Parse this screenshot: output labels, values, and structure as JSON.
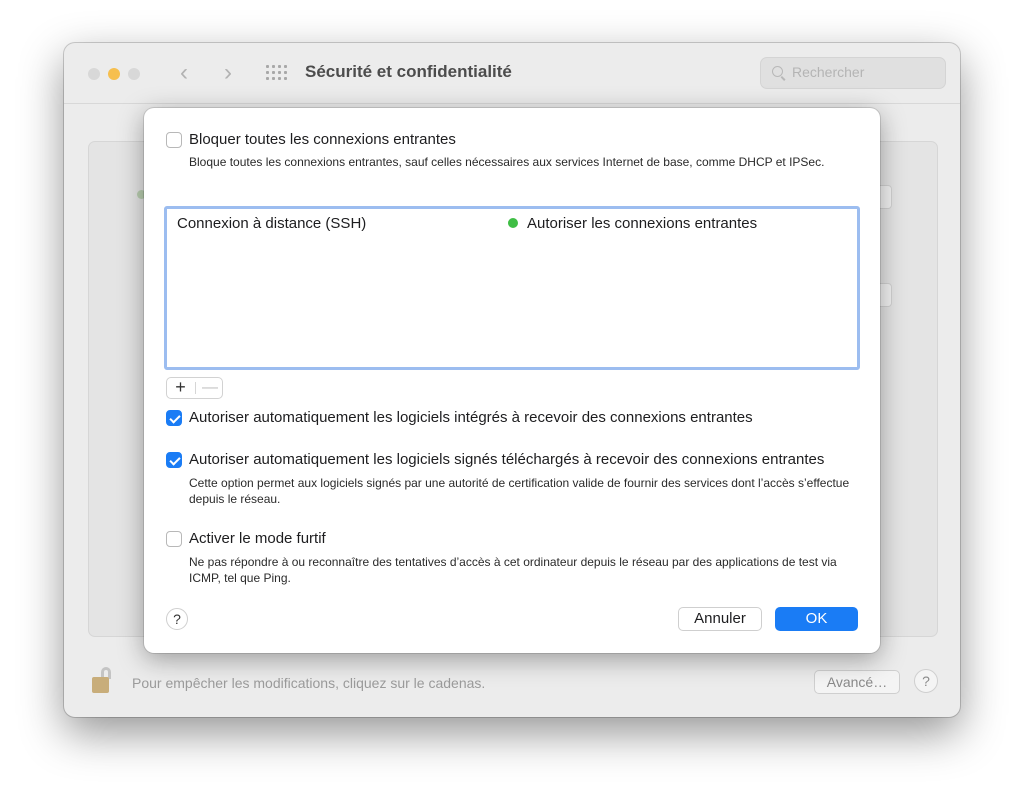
{
  "window": {
    "title": "Sécurité et confidentialité",
    "search_placeholder": "Rechercher",
    "lock_label": "Pour empêcher les modifications, cliquez sur le cadenas.",
    "advanced_label": "Avancé…",
    "help_label": "?"
  },
  "sheet": {
    "block_all": {
      "checked": false,
      "label": "Bloquer toutes les connexions entrantes",
      "description": "Bloque toutes les connexions entrantes, sauf celles nécessaires aux services Internet de base, comme DHCP et IPSec."
    },
    "app_list": [
      {
        "name": "Connexion à distance (SSH)",
        "status": "Autoriser les connexions entrantes",
        "status_color": "#3fbe45"
      }
    ],
    "add_label": "+",
    "remove_label": "—",
    "auto_builtin": {
      "checked": true,
      "label": "Autoriser automatiquement les logiciels intégrés à recevoir des connexions entrantes"
    },
    "auto_signed": {
      "checked": true,
      "label": "Autoriser automatiquement les logiciels signés téléchargés à recevoir des connexions entrantes",
      "description": "Cette option permet aux logiciels signés par une autorité de certification valide de fournir des services dont l’accès s’effectue depuis le réseau."
    },
    "stealth": {
      "checked": false,
      "label": "Activer le mode furtif",
      "description": "Ne pas répondre à ou reconnaître des tentatives d’accès à cet ordinateur depuis le réseau par des applications de test via ICMP, tel que Ping."
    },
    "help_label": "?",
    "cancel_label": "Annuler",
    "ok_label": "OK"
  },
  "colors": {
    "accent": "#1a7cf5",
    "status_green": "#3fbe45",
    "minimize_yellow": "#f6bf4f"
  }
}
